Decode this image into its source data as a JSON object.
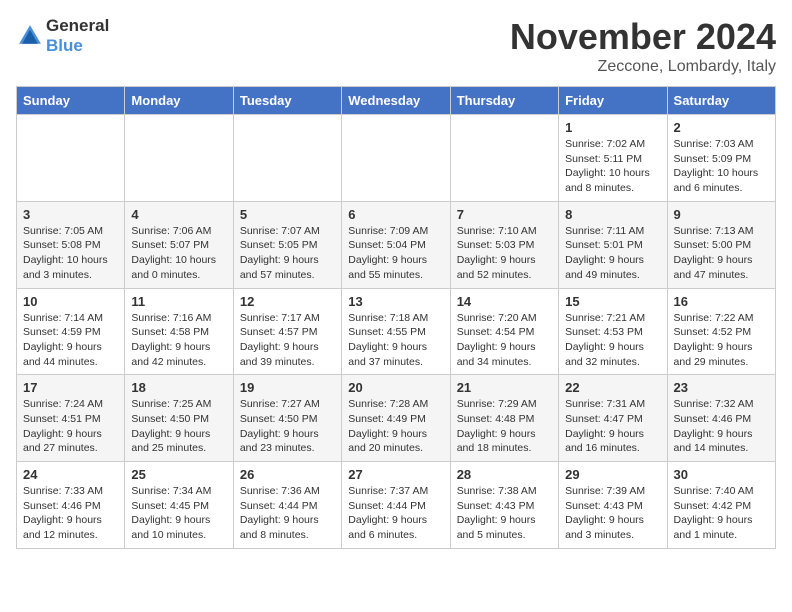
{
  "header": {
    "logo_general": "General",
    "logo_blue": "Blue",
    "month": "November 2024",
    "location": "Zeccone, Lombardy, Italy"
  },
  "weekdays": [
    "Sunday",
    "Monday",
    "Tuesday",
    "Wednesday",
    "Thursday",
    "Friday",
    "Saturday"
  ],
  "weeks": [
    [
      {
        "day": "",
        "info": ""
      },
      {
        "day": "",
        "info": ""
      },
      {
        "day": "",
        "info": ""
      },
      {
        "day": "",
        "info": ""
      },
      {
        "day": "",
        "info": ""
      },
      {
        "day": "1",
        "info": "Sunrise: 7:02 AM\nSunset: 5:11 PM\nDaylight: 10 hours and 8 minutes."
      },
      {
        "day": "2",
        "info": "Sunrise: 7:03 AM\nSunset: 5:09 PM\nDaylight: 10 hours and 6 minutes."
      }
    ],
    [
      {
        "day": "3",
        "info": "Sunrise: 7:05 AM\nSunset: 5:08 PM\nDaylight: 10 hours and 3 minutes."
      },
      {
        "day": "4",
        "info": "Sunrise: 7:06 AM\nSunset: 5:07 PM\nDaylight: 10 hours and 0 minutes."
      },
      {
        "day": "5",
        "info": "Sunrise: 7:07 AM\nSunset: 5:05 PM\nDaylight: 9 hours and 57 minutes."
      },
      {
        "day": "6",
        "info": "Sunrise: 7:09 AM\nSunset: 5:04 PM\nDaylight: 9 hours and 55 minutes."
      },
      {
        "day": "7",
        "info": "Sunrise: 7:10 AM\nSunset: 5:03 PM\nDaylight: 9 hours and 52 minutes."
      },
      {
        "day": "8",
        "info": "Sunrise: 7:11 AM\nSunset: 5:01 PM\nDaylight: 9 hours and 49 minutes."
      },
      {
        "day": "9",
        "info": "Sunrise: 7:13 AM\nSunset: 5:00 PM\nDaylight: 9 hours and 47 minutes."
      }
    ],
    [
      {
        "day": "10",
        "info": "Sunrise: 7:14 AM\nSunset: 4:59 PM\nDaylight: 9 hours and 44 minutes."
      },
      {
        "day": "11",
        "info": "Sunrise: 7:16 AM\nSunset: 4:58 PM\nDaylight: 9 hours and 42 minutes."
      },
      {
        "day": "12",
        "info": "Sunrise: 7:17 AM\nSunset: 4:57 PM\nDaylight: 9 hours and 39 minutes."
      },
      {
        "day": "13",
        "info": "Sunrise: 7:18 AM\nSunset: 4:55 PM\nDaylight: 9 hours and 37 minutes."
      },
      {
        "day": "14",
        "info": "Sunrise: 7:20 AM\nSunset: 4:54 PM\nDaylight: 9 hours and 34 minutes."
      },
      {
        "day": "15",
        "info": "Sunrise: 7:21 AM\nSunset: 4:53 PM\nDaylight: 9 hours and 32 minutes."
      },
      {
        "day": "16",
        "info": "Sunrise: 7:22 AM\nSunset: 4:52 PM\nDaylight: 9 hours and 29 minutes."
      }
    ],
    [
      {
        "day": "17",
        "info": "Sunrise: 7:24 AM\nSunset: 4:51 PM\nDaylight: 9 hours and 27 minutes."
      },
      {
        "day": "18",
        "info": "Sunrise: 7:25 AM\nSunset: 4:50 PM\nDaylight: 9 hours and 25 minutes."
      },
      {
        "day": "19",
        "info": "Sunrise: 7:27 AM\nSunset: 4:50 PM\nDaylight: 9 hours and 23 minutes."
      },
      {
        "day": "20",
        "info": "Sunrise: 7:28 AM\nSunset: 4:49 PM\nDaylight: 9 hours and 20 minutes."
      },
      {
        "day": "21",
        "info": "Sunrise: 7:29 AM\nSunset: 4:48 PM\nDaylight: 9 hours and 18 minutes."
      },
      {
        "day": "22",
        "info": "Sunrise: 7:31 AM\nSunset: 4:47 PM\nDaylight: 9 hours and 16 minutes."
      },
      {
        "day": "23",
        "info": "Sunrise: 7:32 AM\nSunset: 4:46 PM\nDaylight: 9 hours and 14 minutes."
      }
    ],
    [
      {
        "day": "24",
        "info": "Sunrise: 7:33 AM\nSunset: 4:46 PM\nDaylight: 9 hours and 12 minutes."
      },
      {
        "day": "25",
        "info": "Sunrise: 7:34 AM\nSunset: 4:45 PM\nDaylight: 9 hours and 10 minutes."
      },
      {
        "day": "26",
        "info": "Sunrise: 7:36 AM\nSunset: 4:44 PM\nDaylight: 9 hours and 8 minutes."
      },
      {
        "day": "27",
        "info": "Sunrise: 7:37 AM\nSunset: 4:44 PM\nDaylight: 9 hours and 6 minutes."
      },
      {
        "day": "28",
        "info": "Sunrise: 7:38 AM\nSunset: 4:43 PM\nDaylight: 9 hours and 5 minutes."
      },
      {
        "day": "29",
        "info": "Sunrise: 7:39 AM\nSunset: 4:43 PM\nDaylight: 9 hours and 3 minutes."
      },
      {
        "day": "30",
        "info": "Sunrise: 7:40 AM\nSunset: 4:42 PM\nDaylight: 9 hours and 1 minute."
      }
    ]
  ]
}
